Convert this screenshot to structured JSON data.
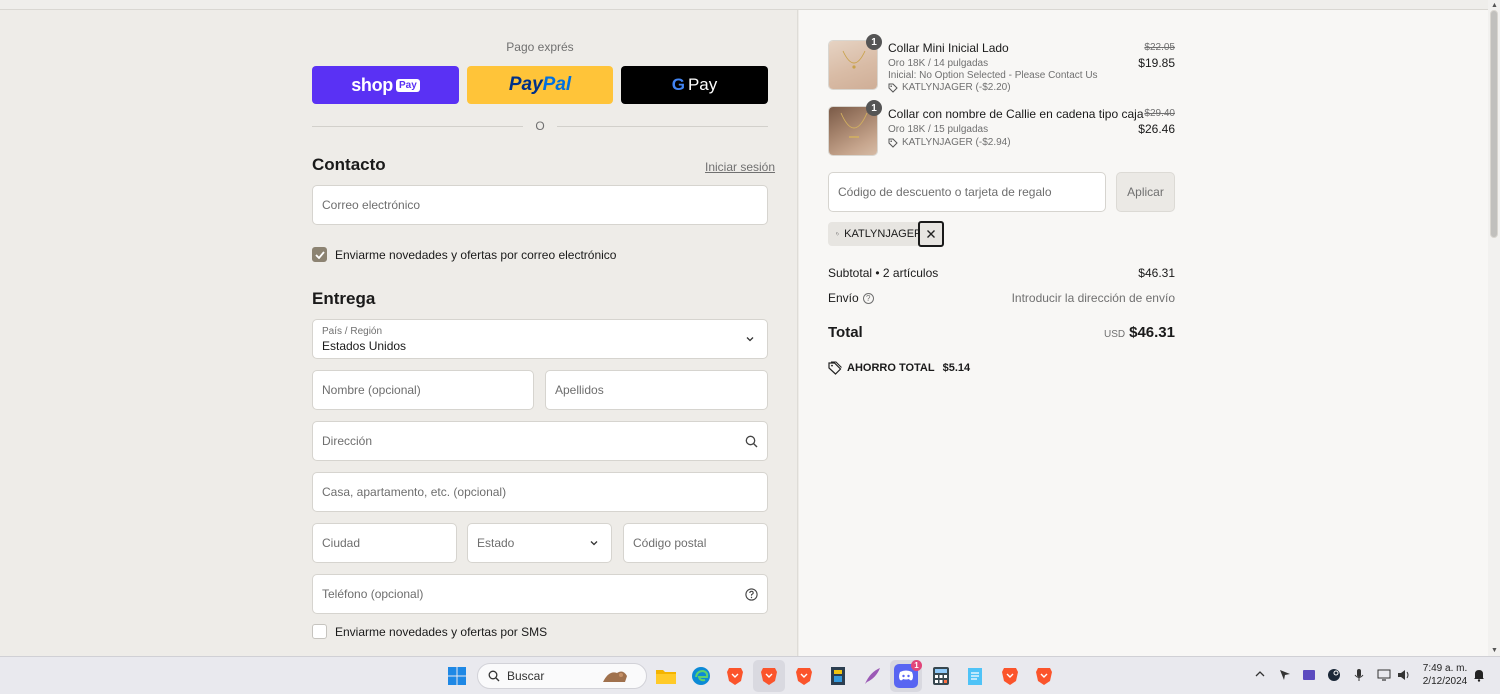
{
  "express": {
    "label": "Pago exprés",
    "shop_word": "shop",
    "shop_pay": "Pay",
    "paypal_part1": "Pay",
    "paypal_part2": "Pal",
    "gpay_g": "G",
    "gpay_word": "Pay",
    "or": "O"
  },
  "contact": {
    "title": "Contacto",
    "login_link": "Iniciar sesión",
    "email_placeholder": "Correo electrónico",
    "newsletter_label": "Enviarme novedades y ofertas por correo electrónico",
    "newsletter_checked": true
  },
  "delivery": {
    "title": "Entrega",
    "country_label": "País / Región",
    "country_value": "Estados Unidos",
    "first_name_placeholder": "Nombre (opcional)",
    "last_name_placeholder": "Apellidos",
    "address_placeholder": "Dirección",
    "apartment_placeholder": "Casa, apartamento, etc. (opcional)",
    "city_placeholder": "Ciudad",
    "state_placeholder": "Estado",
    "zip_placeholder": "Código postal",
    "phone_placeholder": "Teléfono (opcional)",
    "sms_label": "Enviarme novedades y ofertas por SMS",
    "sms_checked": false
  },
  "cart": {
    "items": [
      {
        "qty": "1",
        "name": "Collar Mini Inicial Lado",
        "variant": "Oro 18K / 14 pulgadas",
        "note": "Inicial: No Option Selected - Please Contact Us",
        "discount": "KATLYNJAGER (-$2.20)",
        "old_price": "$22.05",
        "price": "$19.85"
      },
      {
        "qty": "1",
        "name": "Collar con nombre de Callie en cadena tipo caja",
        "variant": "Oro 18K / 15 pulgadas",
        "discount": "KATLYNJAGER (-$2.94)",
        "old_price": "$29.40",
        "price": "$26.46"
      }
    ],
    "discount_placeholder": "Código de descuento o tarjeta de regalo",
    "apply_label": "Aplicar",
    "applied_code": "KATLYNJAGER",
    "subtotal_label": "Subtotal • 2 artículos",
    "subtotal_value": "$46.31",
    "shipping_label": "Envío",
    "shipping_value": "Introducir la dirección de envío",
    "total_label": "Total",
    "total_currency": "USD",
    "total_value": "$46.31",
    "savings_label": "AHORRO TOTAL",
    "savings_value": "$5.14"
  },
  "taskbar": {
    "search_label": "Buscar",
    "discord_badge": "1",
    "time": "7:49 a. m.",
    "date": "2/12/2024"
  }
}
